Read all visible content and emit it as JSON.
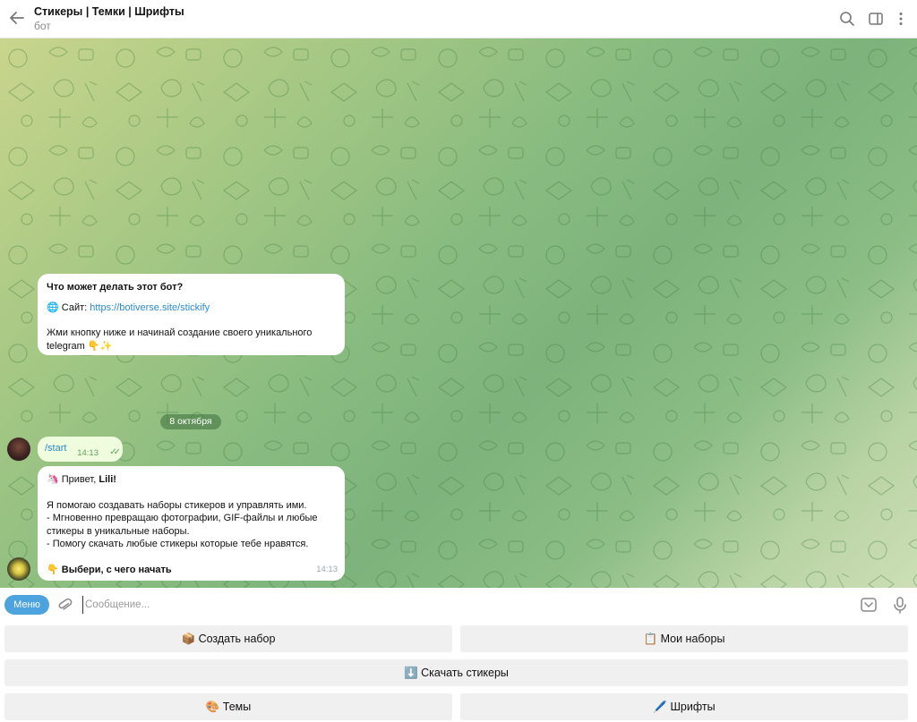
{
  "header": {
    "title": "Стикеры | Темки | Шрифты",
    "subtitle": "бот"
  },
  "chat": {
    "bot_info": {
      "heading": "Что может делать этот бот?",
      "site_icon": "🌐",
      "site_label": "Сайт:",
      "site_url": "https://botiverse.site/stickify",
      "text": "Жми кнопку ниже и начинай создание своего уникального telegram 👇✨"
    },
    "date_badge": "8 октября",
    "user_message": {
      "text": "/start",
      "time": "14:13",
      "status": "✓✓"
    },
    "bot_reply": {
      "greeting_emoji": "🦄",
      "greeting_text": "Привет,",
      "name": "Lili",
      "greeting_end": "!",
      "line1": "Я помогаю создавать наборы стикеров и управлять ими.",
      "line2": "- Мгновенно превращаю фотографии, GIF-файлы и любые стикеры в уникальные наборы.",
      "line3": "- Помогу скачать любые стикеры которые тебе нравятся.",
      "cta_emoji": "👇",
      "cta": "Выбери, с чего начать",
      "time": "14:13"
    }
  },
  "input": {
    "menu_label": "Меню",
    "placeholder": "Сообщение..."
  },
  "keyboard": {
    "create_set": "📦 Создать набор",
    "my_sets": "📋 Мои наборы",
    "download": "⬇️ Скачать стикеры",
    "themes": "🎨 Темы",
    "fonts": "🖊️ Шрифты"
  },
  "colors": {
    "accent": "#4ca3dd",
    "link": "#2b8bd1",
    "outgoing_bubble": "#effdde"
  }
}
